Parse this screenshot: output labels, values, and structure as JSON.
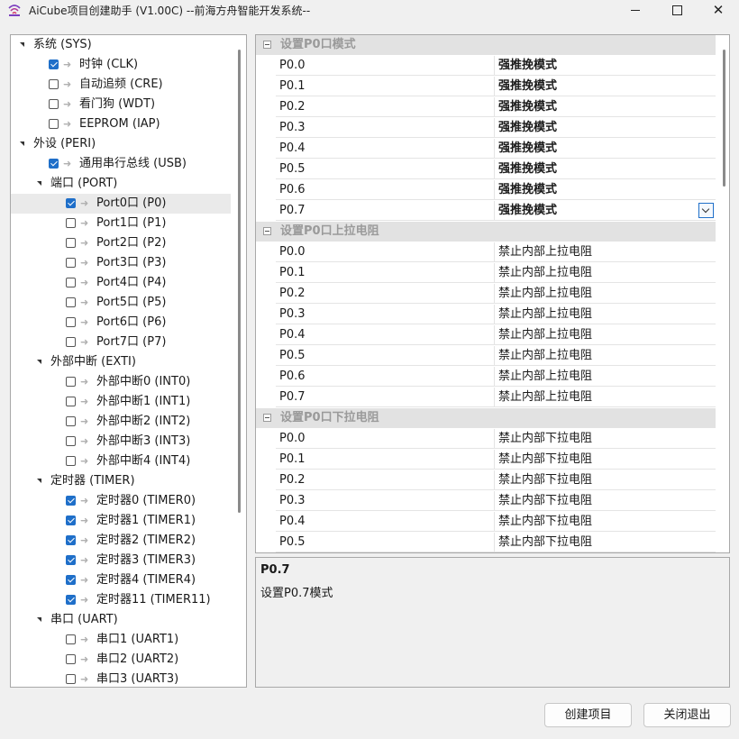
{
  "window": {
    "title": "AiCube项目创建助手 (V1.00C) --前海方舟智能开发系统--",
    "icon": "wifi-signal-icon"
  },
  "tree": [
    {
      "label": "系统 (SYS)",
      "level": 0,
      "type": "group"
    },
    {
      "label": "时钟 (CLK)",
      "level": 1,
      "type": "item",
      "checked": true
    },
    {
      "label": "自动追频 (CRE)",
      "level": 1,
      "type": "item",
      "checked": false
    },
    {
      "label": "看门狗 (WDT)",
      "level": 1,
      "type": "item",
      "checked": false
    },
    {
      "label": "EEPROM (IAP)",
      "level": 1,
      "type": "item",
      "checked": false
    },
    {
      "label": "外设 (PERI)",
      "level": 0,
      "type": "group"
    },
    {
      "label": "通用串行总线 (USB)",
      "level": 1,
      "type": "item",
      "checked": true
    },
    {
      "label": "端口 (PORT)",
      "level": 1,
      "type": "group"
    },
    {
      "label": "Port0口 (P0)",
      "level": 2,
      "type": "item",
      "checked": true,
      "selected": true
    },
    {
      "label": "Port1口 (P1)",
      "level": 2,
      "type": "item",
      "checked": false
    },
    {
      "label": "Port2口 (P2)",
      "level": 2,
      "type": "item",
      "checked": false
    },
    {
      "label": "Port3口 (P3)",
      "level": 2,
      "type": "item",
      "checked": false
    },
    {
      "label": "Port4口 (P4)",
      "level": 2,
      "type": "item",
      "checked": false
    },
    {
      "label": "Port5口 (P5)",
      "level": 2,
      "type": "item",
      "checked": false
    },
    {
      "label": "Port6口 (P6)",
      "level": 2,
      "type": "item",
      "checked": false
    },
    {
      "label": "Port7口 (P7)",
      "level": 2,
      "type": "item",
      "checked": false
    },
    {
      "label": "外部中断 (EXTI)",
      "level": 1,
      "type": "group"
    },
    {
      "label": "外部中断0 (INT0)",
      "level": 2,
      "type": "item",
      "checked": false
    },
    {
      "label": "外部中断1 (INT1)",
      "level": 2,
      "type": "item",
      "checked": false
    },
    {
      "label": "外部中断2 (INT2)",
      "level": 2,
      "type": "item",
      "checked": false
    },
    {
      "label": "外部中断3 (INT3)",
      "level": 2,
      "type": "item",
      "checked": false
    },
    {
      "label": "外部中断4 (INT4)",
      "level": 2,
      "type": "item",
      "checked": false
    },
    {
      "label": "定时器 (TIMER)",
      "level": 1,
      "type": "group"
    },
    {
      "label": "定时器0 (TIMER0)",
      "level": 2,
      "type": "item",
      "checked": true
    },
    {
      "label": "定时器1 (TIMER1)",
      "level": 2,
      "type": "item",
      "checked": true
    },
    {
      "label": "定时器2 (TIMER2)",
      "level": 2,
      "type": "item",
      "checked": true
    },
    {
      "label": "定时器3 (TIMER3)",
      "level": 2,
      "type": "item",
      "checked": true
    },
    {
      "label": "定时器4 (TIMER4)",
      "level": 2,
      "type": "item",
      "checked": true
    },
    {
      "label": "定时器11 (TIMER11)",
      "level": 2,
      "type": "item",
      "checked": true
    },
    {
      "label": "串口 (UART)",
      "level": 1,
      "type": "group"
    },
    {
      "label": "串口1 (UART1)",
      "level": 2,
      "type": "item",
      "checked": false
    },
    {
      "label": "串口2 (UART2)",
      "level": 2,
      "type": "item",
      "checked": false
    },
    {
      "label": "串口3 (UART3)",
      "level": 2,
      "type": "item",
      "checked": false
    }
  ],
  "property_grid": [
    {
      "category": "设置P0口模式",
      "bold_values": true,
      "rows": [
        {
          "name": "P0.0",
          "value": "强推挽模式"
        },
        {
          "name": "P0.1",
          "value": "强推挽模式"
        },
        {
          "name": "P0.2",
          "value": "强推挽模式"
        },
        {
          "name": "P0.3",
          "value": "强推挽模式"
        },
        {
          "name": "P0.4",
          "value": "强推挽模式"
        },
        {
          "name": "P0.5",
          "value": "强推挽模式"
        },
        {
          "name": "P0.6",
          "value": "强推挽模式"
        },
        {
          "name": "P0.7",
          "value": "强推挽模式",
          "selected": true
        }
      ]
    },
    {
      "category": "设置P0口上拉电阻",
      "bold_values": false,
      "rows": [
        {
          "name": "P0.0",
          "value": "禁止内部上拉电阻"
        },
        {
          "name": "P0.1",
          "value": "禁止内部上拉电阻"
        },
        {
          "name": "P0.2",
          "value": "禁止内部上拉电阻"
        },
        {
          "name": "P0.3",
          "value": "禁止内部上拉电阻"
        },
        {
          "name": "P0.4",
          "value": "禁止内部上拉电阻"
        },
        {
          "name": "P0.5",
          "value": "禁止内部上拉电阻"
        },
        {
          "name": "P0.6",
          "value": "禁止内部上拉电阻"
        },
        {
          "name": "P0.7",
          "value": "禁止内部上拉电阻"
        }
      ]
    },
    {
      "category": "设置P0口下拉电阻",
      "bold_values": false,
      "rows": [
        {
          "name": "P0.0",
          "value": "禁止内部下拉电阻"
        },
        {
          "name": "P0.1",
          "value": "禁止内部下拉电阻"
        },
        {
          "name": "P0.2",
          "value": "禁止内部下拉电阻"
        },
        {
          "name": "P0.3",
          "value": "禁止内部下拉电阻"
        },
        {
          "name": "P0.4",
          "value": "禁止内部下拉电阻"
        },
        {
          "name": "P0.5",
          "value": "禁止内部下拉电阻"
        }
      ]
    }
  ],
  "description": {
    "title": "P0.7",
    "text": "设置P0.7模式"
  },
  "buttons": {
    "create": "创建项目",
    "close": "关闭退出"
  },
  "colors": {
    "accent": "#1f6fc9",
    "category_bg": "#e2e2e2",
    "category_text": "#9a9a9a"
  }
}
